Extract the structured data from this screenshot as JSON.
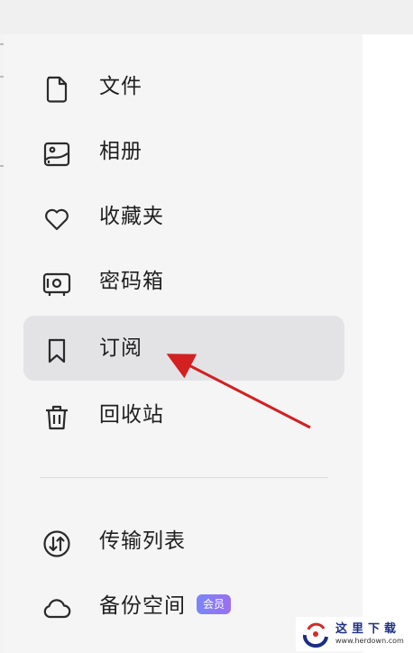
{
  "sidebar": {
    "items": [
      {
        "label": "文件",
        "icon": "file-icon"
      },
      {
        "label": "相册",
        "icon": "photo-album-icon"
      },
      {
        "label": "收藏夹",
        "icon": "heart-icon"
      },
      {
        "label": "密码箱",
        "icon": "safe-box-icon"
      },
      {
        "label": "订阅",
        "icon": "bookmark-icon",
        "selected": true
      },
      {
        "label": "回收站",
        "icon": "trash-icon"
      },
      {
        "label": "传输列表",
        "icon": "transfer-icon"
      },
      {
        "label": "备份空间",
        "icon": "cloud-icon",
        "badge": "会员"
      }
    ]
  },
  "colors": {
    "sidebar_bg": "#f5f5f6",
    "selected_bg": "#e3e3e6",
    "badge_bg": "#6f7cf5",
    "annotation_arrow": "#d32020"
  },
  "watermark": {
    "title": "这里下载",
    "url": "www.herdown.com"
  }
}
